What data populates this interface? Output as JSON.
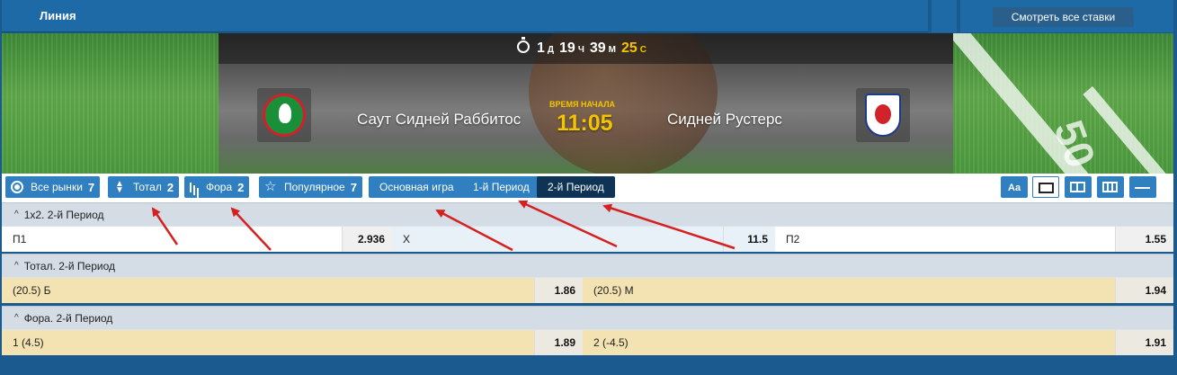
{
  "header": {
    "title": "Линия",
    "see_all_label": "Смотреть все ставки"
  },
  "banner": {
    "timer": {
      "days": "1",
      "days_unit": "Д",
      "hours": "19",
      "hours_unit": "Ч",
      "minutes": "39",
      "minutes_unit": "М",
      "seconds": "25",
      "seconds_unit": "С"
    },
    "home_team": "Саут Сидней Раббитос",
    "away_team": "Сидней Рустерс",
    "start_label": "ВРЕМЯ НАЧАЛА",
    "start_time": "11:05"
  },
  "filters": {
    "all_markets": {
      "label": "Все рынки",
      "count": "7"
    },
    "total": {
      "label": "Тотал",
      "count": "2"
    },
    "handicap": {
      "label": "Фора",
      "count": "2"
    },
    "popular": {
      "label": "Популярное",
      "count": "7"
    },
    "main_game": "Основная игра",
    "period1": "1-й Период",
    "period2": "2-й Период",
    "active": "period2",
    "font_size_label": "Aa"
  },
  "markets": [
    {
      "title": "1х2. 2-й Период",
      "outcomes": [
        {
          "label": "П1",
          "odd": "2.936"
        },
        {
          "label": "Х",
          "odd": "11.5"
        },
        {
          "label": "П2",
          "odd": "1.55"
        }
      ]
    },
    {
      "title": "Тотал. 2-й Период",
      "outcomes": [
        {
          "label": "(20.5) Б",
          "odd": "1.86"
        },
        {
          "label": "(20.5) М",
          "odd": "1.94"
        }
      ]
    },
    {
      "title": "Фора. 2-й Период",
      "outcomes": [
        {
          "label": "1 (4.5)",
          "odd": "1.89"
        },
        {
          "label": "2 (-4.5)",
          "odd": "1.91"
        }
      ]
    }
  ],
  "colors": {
    "accent_blue": "#2f7fc1",
    "active_tab": "#0e3354",
    "timer_yellow": "#f5c400",
    "annotation_arrow": "#d62020"
  }
}
